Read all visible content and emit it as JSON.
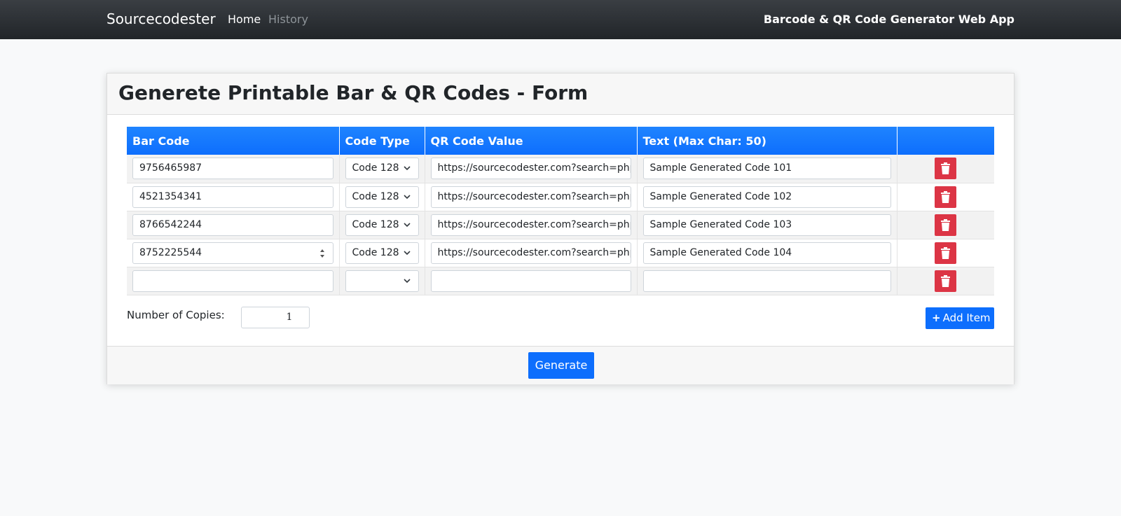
{
  "navbar": {
    "brand": "Sourcecodester",
    "links": {
      "home": "Home",
      "history": "History"
    },
    "app_title": "Barcode & QR Code Generator Web App"
  },
  "card": {
    "title": "Generete Printable Bar & QR Codes - Form"
  },
  "table": {
    "headers": {
      "bar_code": "Bar Code",
      "code_type": "Code Type",
      "qr_value": "QR Code Value",
      "text": "Text (Max Char: 50)",
      "actions": ""
    },
    "rows": [
      {
        "bar_code": "9756465987",
        "code_type": "Code 128",
        "qr_value": "https://sourcecodester.com?search=php r",
        "text": "Sample Generated Code 101"
      },
      {
        "bar_code": "4521354341",
        "code_type": "Code 128",
        "qr_value": "https://sourcecodester.com?search=php t",
        "text": "Sample Generated Code 102"
      },
      {
        "bar_code": "8766542244",
        "code_type": "Code 128",
        "qr_value": "https://sourcecodester.com?search=php C",
        "text": "Sample Generated Code 103"
      },
      {
        "bar_code": "8752225544",
        "code_type": "Code 128",
        "qr_value": "https://sourcecodester.com?search=php E",
        "text": "Sample Generated Code 104"
      },
      {
        "bar_code": "",
        "code_type": "",
        "qr_value": "",
        "text": ""
      }
    ]
  },
  "copies": {
    "label": "Number of Copies:",
    "value": "1"
  },
  "buttons": {
    "add_item": "Add Item",
    "generate": "Generate"
  },
  "colors": {
    "primary": "#0d6efd",
    "danger": "#dc3545",
    "navbar": "#212529"
  }
}
